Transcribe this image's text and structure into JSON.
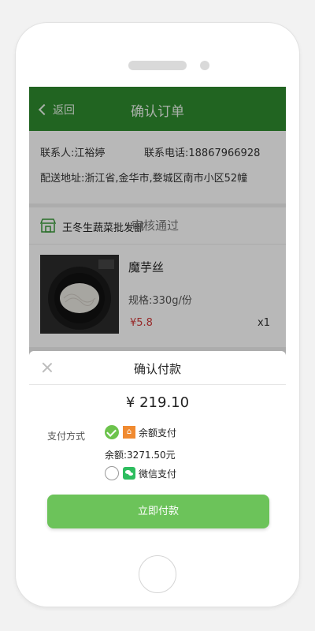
{
  "header": {
    "back_label": "返回",
    "title": "确认订单"
  },
  "address": {
    "contact": "联系人:江裕婷",
    "phone": "联系电话:18867966928",
    "addr": "配送地址:浙江省,金华市,婺城区南市小区52幢"
  },
  "shop": {
    "name": "王冬生蔬菜批发部",
    "status": "审核通过"
  },
  "product": {
    "name": "魔芋丝",
    "spec": "规格:330g/份",
    "price": "¥5.8",
    "qty": "x1"
  },
  "payment": {
    "title": "确认付款",
    "amount": "¥ 219.10",
    "method_label": "支付方式",
    "options": [
      {
        "label": "余额支付",
        "selected": true,
        "icon": "balance-icon"
      },
      {
        "label": "微信支付",
        "selected": false,
        "icon": "wechat-icon"
      }
    ],
    "balance": "余额:3271.50元",
    "pay_button": "立即付款"
  },
  "colors": {
    "header": "#2f8b2f",
    "accent": "#6cc35a",
    "price": "#d23b3b"
  }
}
